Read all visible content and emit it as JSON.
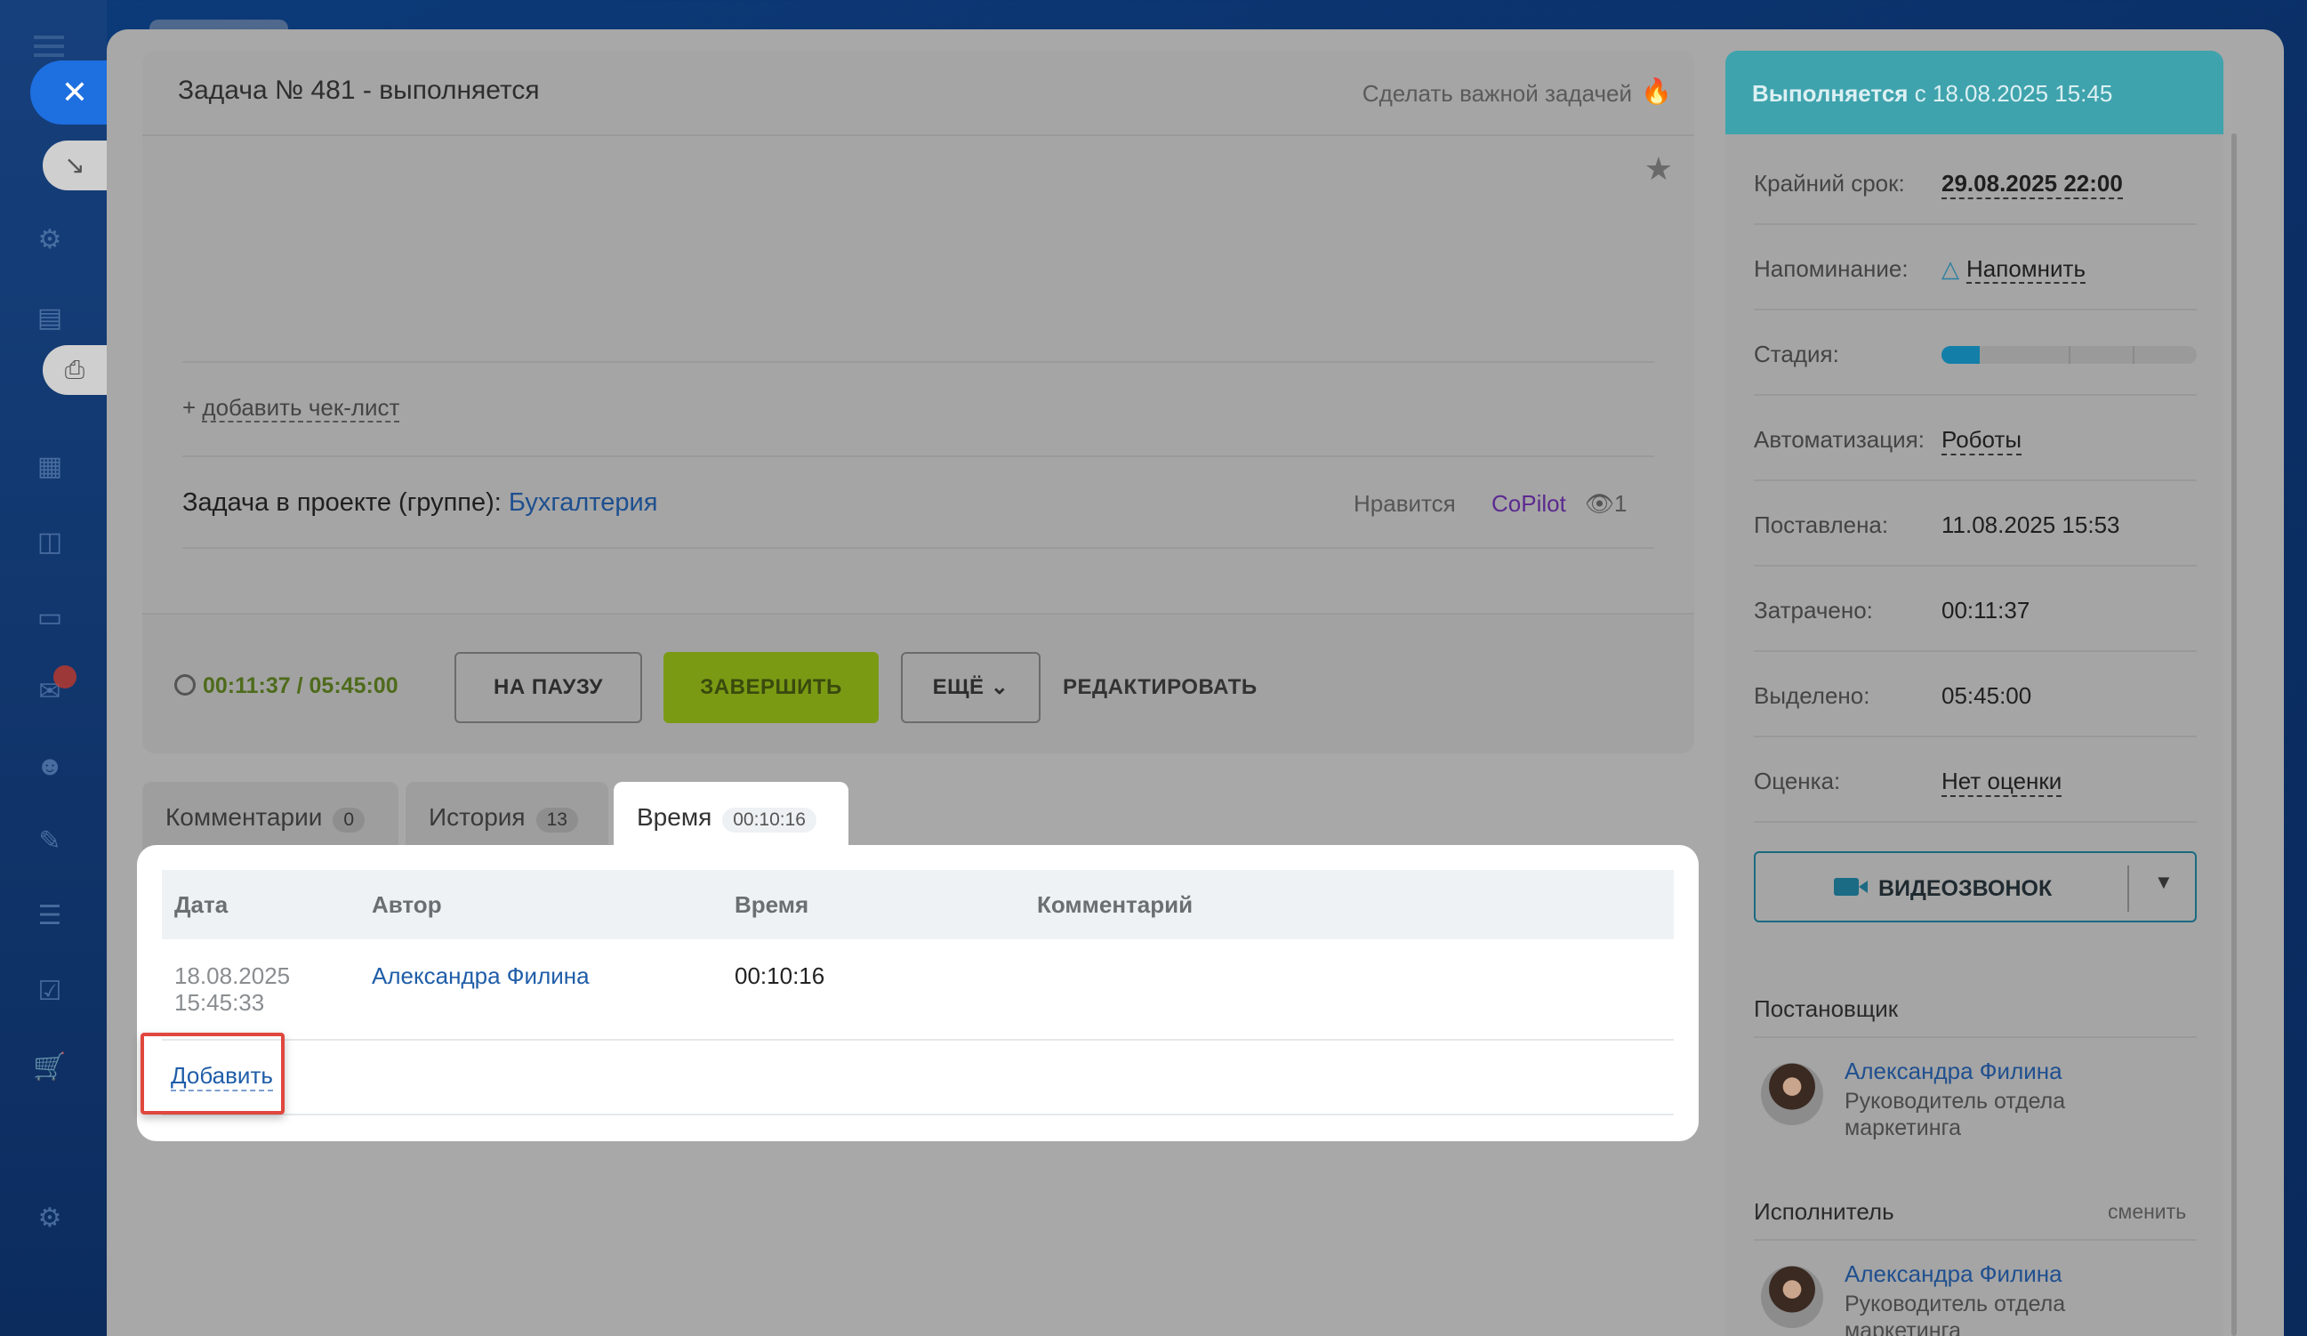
{
  "task": {
    "title": "Задача № 481 - выполняется",
    "make_important": "Сделать важной задачей",
    "add_checklist": "добавить чек-лист",
    "add_checklist_prefix": "+ ",
    "project_label": "Задача в проекте (группе):",
    "project_name": "Бухгалтерия",
    "like_label": "Нравится",
    "copilot": "CoPilot",
    "views": "1",
    "timer": "00:11:37 / 05:45:00",
    "buttons": {
      "pause": "НА ПАУЗУ",
      "finish": "ЗАВЕРШИТЬ",
      "more": "ЕЩЁ",
      "edit": "РЕДАКТИРОВАТЬ"
    }
  },
  "tabs": [
    {
      "label": "Комментарии",
      "count": "0"
    },
    {
      "label": "История",
      "count": "13"
    },
    {
      "label": "Время",
      "count": "00:10:16",
      "active": true
    }
  ],
  "time_table": {
    "headers": [
      "Дата",
      "Автор",
      "Время",
      "Комментарий"
    ],
    "rows": [
      {
        "date": "18.08.2025 15:45:33",
        "author": "Александра Филина",
        "time": "00:10:16",
        "comment": ""
      }
    ],
    "add_label": "Добавить",
    "highlight_color": "#e0473e"
  },
  "sidebar_info": {
    "status_prefix": "Выполняется",
    "status_since": "с 18.08.2025 15:45",
    "rows": [
      {
        "label": "Крайний срок:",
        "value": "29.08.2025 22:00"
      },
      {
        "label": "Напоминание:",
        "value": "Напомнить"
      },
      {
        "label": "Стадия:",
        "value": ""
      },
      {
        "label": "Автоматизация:",
        "value": "Роботы"
      },
      {
        "label": "Поставлена:",
        "value": "11.08.2025 15:53"
      },
      {
        "label": "Затрачено:",
        "value": "00:11:37"
      },
      {
        "label": "Выделено:",
        "value": "05:45:00"
      },
      {
        "label": "Оценка:",
        "value": "Нет оценки"
      }
    ],
    "stage": {
      "filled_segments": 1,
      "total_segments": 4
    },
    "video_call": "ВИДЕОЗВОНОК",
    "creator_title": "Постановщик",
    "creator": {
      "name": "Александра Филина",
      "role": "Руководитель отдела маркетинга"
    },
    "executor_title": "Исполнитель",
    "executor_change": "сменить",
    "executor": {
      "name": "Александра Филина",
      "role": "Руководитель отдела маркетинга"
    }
  },
  "colors": {
    "status_bar": "#3fa3ad",
    "finish_button": "#7a9a14",
    "link": "#1f5da8"
  },
  "icons": [
    "close-icon",
    "print-icon",
    "fire-icon",
    "star-icon",
    "clock-icon",
    "bell-icon",
    "camera-icon",
    "chevron-down-icon",
    "eye-icon"
  ]
}
